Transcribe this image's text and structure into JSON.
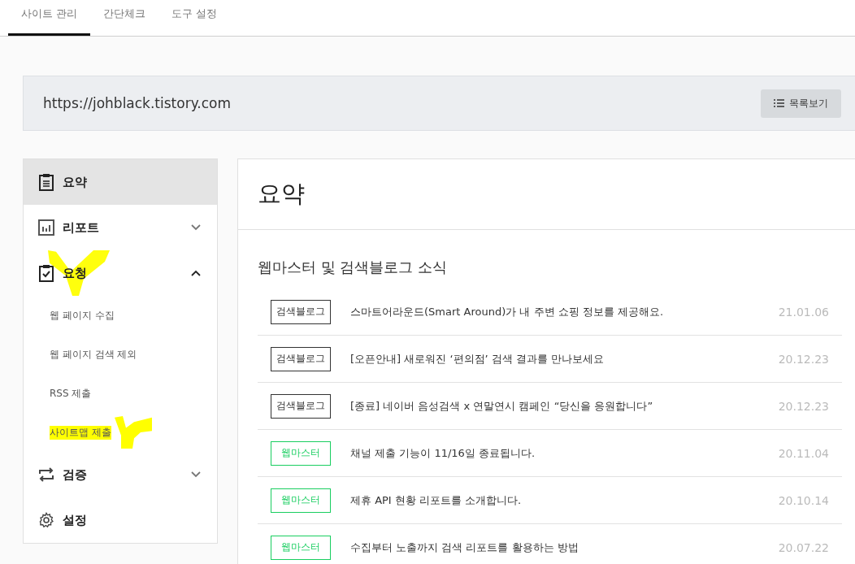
{
  "tabs": [
    {
      "label": "사이트 관리",
      "selected": true
    },
    {
      "label": "간단체크",
      "selected": false
    },
    {
      "label": "도구 설정",
      "selected": false
    }
  ],
  "site": {
    "url": "https://johblack.tistory.com",
    "list_button": "목록보기"
  },
  "sidebar": {
    "items": [
      {
        "kind": "section",
        "label": "요약",
        "selected": true,
        "highlighted": false
      },
      {
        "kind": "section",
        "label": "리포트",
        "selected": false,
        "expanded": false,
        "highlighted": false
      },
      {
        "kind": "section",
        "label": "요청",
        "selected": false,
        "expanded": true,
        "highlighted": true
      },
      {
        "kind": "sub",
        "label": "웹 페이지 수집",
        "selected": false,
        "highlighted": false
      },
      {
        "kind": "sub",
        "label": "웹 페이지 검색 제외",
        "selected": false,
        "highlighted": false
      },
      {
        "kind": "sub",
        "label": "RSS 제출",
        "selected": false,
        "highlighted": false
      },
      {
        "kind": "sub",
        "label": "사이트맵 제출",
        "selected": false,
        "highlighted": true
      },
      {
        "kind": "section",
        "label": "검증",
        "selected": false,
        "expanded": false,
        "highlighted": false
      },
      {
        "kind": "section",
        "label": "설정",
        "selected": false,
        "highlighted": false
      }
    ]
  },
  "main": {
    "title": "요약",
    "news_heading": "웹마스터 및 검색블로그 소식",
    "news": [
      {
        "tag": "검색블로그",
        "color": "#333333",
        "title": "스마트어라운드(Smart Around)가 내 주변 쇼핑 정보를 제공해요.",
        "date": "21.01.06"
      },
      {
        "tag": "검색블로그",
        "color": "#333333",
        "title": "[오픈안내] 새로워진 ‘편의점’ 검색 결과를 만나보세요",
        "date": "20.12.23"
      },
      {
        "tag": "검색블로그",
        "color": "#333333",
        "title": "[종료] 네이버 음성검색 x 연말연시 캠페인 “당신을 응원합니다”",
        "date": "20.12.23"
      },
      {
        "tag": "웹마스터",
        "color": "#19ce60",
        "title": "채널 제출 기능이 11/16일 종료됩니다.",
        "date": "20.11.04"
      },
      {
        "tag": "웹마스터",
        "color": "#19ce60",
        "title": "제휴 API 현황 리포트를 소개합니다.",
        "date": "20.10.14"
      },
      {
        "tag": "웹마스터",
        "color": "#19ce60",
        "title": "수집부터 노출까지 검색 리포트를 활용하는 방법",
        "date": "20.07.22"
      }
    ]
  }
}
